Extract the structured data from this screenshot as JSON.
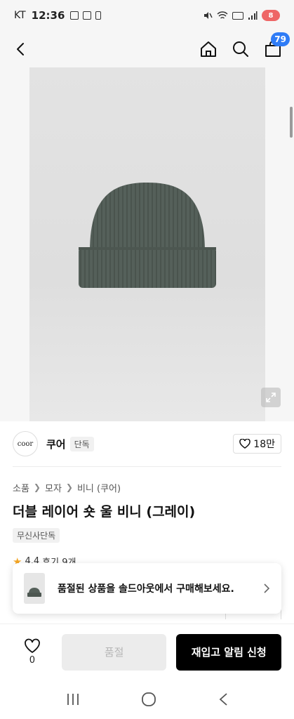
{
  "status_bar": {
    "carrier": "KT",
    "time": "12:36",
    "battery": "8"
  },
  "nav": {
    "cart_count": "79"
  },
  "brand": {
    "logo_text": "coor",
    "name": "쿠어",
    "tag": "단독",
    "likes": "18만"
  },
  "breadcrumb": [
    "소품",
    "모자",
    "비니 (쿠어)"
  ],
  "product": {
    "title": "더블 레이어 숏 울 비니 (그레이)",
    "exclusive_tag": "무신사단독",
    "rating": "4.4",
    "reviews": "후기 9개"
  },
  "popup": {
    "message": "품절된 상품을 솔드아웃에서 구매해보세요."
  },
  "action_bar": {
    "wish_count": "0",
    "soldout_label": "품절",
    "restock_label": "재입고 알림 신청"
  },
  "colors": {
    "accent": "#2f7cf6",
    "beanie": "#55605a",
    "star": "#f5a623"
  }
}
